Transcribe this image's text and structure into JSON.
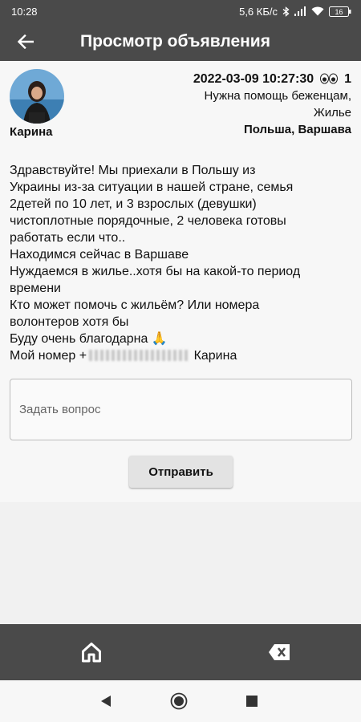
{
  "status_bar": {
    "time": "10:28",
    "speed": "5,6 КБ/с",
    "battery": "16"
  },
  "app_bar": {
    "title": "Просмотр объявления"
  },
  "post": {
    "author": "Карина",
    "datetime": "2022-03-09 10:27:30",
    "views": "1",
    "category": "Нужна помощь беженцам,",
    "subcategory": "Жилье",
    "location": "Польша, Варшава",
    "text_lines": [
      "Здравствуйте! Мы приехали в Польшу из",
      "Украины из-за ситуации в нашей стране, семья",
      "2детей по 10 лет, и 3 взрослых (девушки)",
      "чистоплотные порядочные, 2 человека готовы",
      "работать если что..",
      "Находимся сейчас в Варшаве",
      "Нуждаемся в жилье..хотя бы на какой-то период",
      "времени",
      "Кто может помочь с жильём? Или номера",
      "волонтеров хотя бы",
      "Буду очень благодарна 🙏"
    ],
    "phone_label": "Мой номер +",
    "phone_suffix": "Карина"
  },
  "question": {
    "placeholder": "Задать вопрос",
    "value": ""
  },
  "send_label": "Отправить",
  "icons": {
    "back": "back-arrow-icon",
    "views": "eyes-icon",
    "home": "home-icon",
    "clear": "backspace-icon"
  },
  "colors": {
    "bar": "#4a4a4a",
    "background": "#f7f7f7",
    "button": "#e3e3e3"
  }
}
